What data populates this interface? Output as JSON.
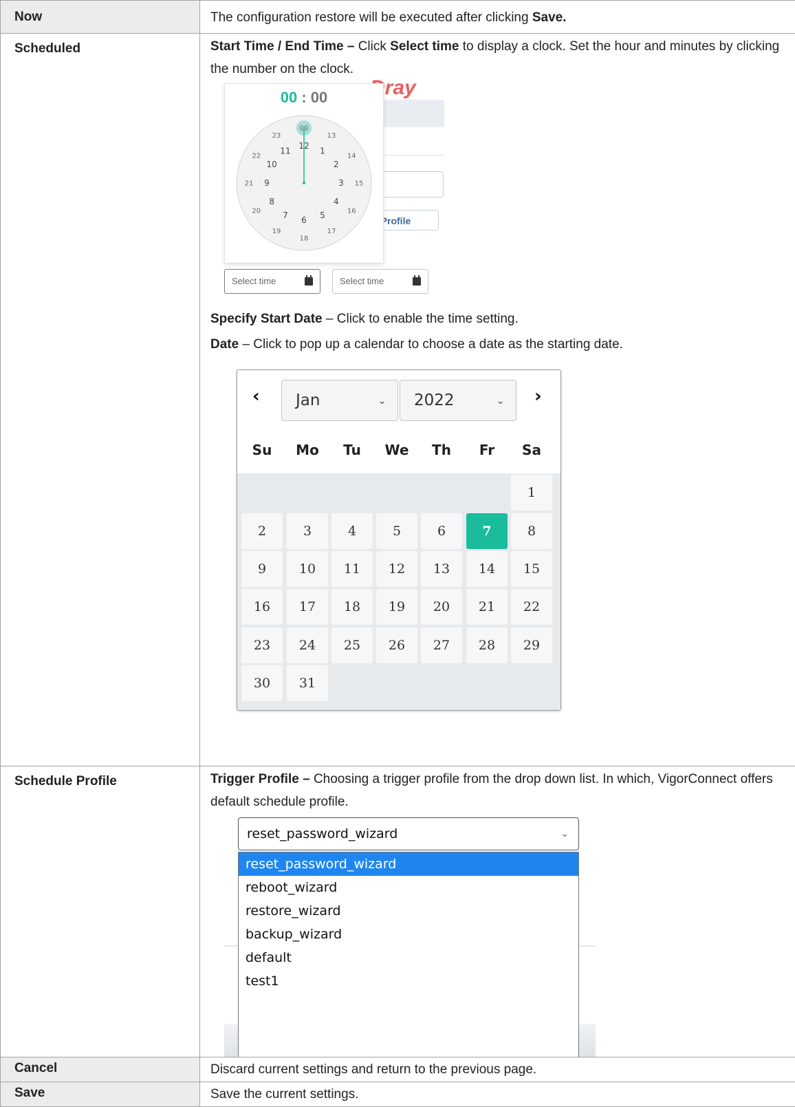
{
  "rows": {
    "now": {
      "term": "Now",
      "desc_prefix": "The configuration restore will be executed after clicking ",
      "desc_bold": "Save."
    },
    "scheduled": {
      "term": "Scheduled",
      "p1_bold": "Start Time / End Time – ",
      "p1_a": "Click ",
      "p1_b_bold": "Select time",
      "p1_c": " to display a clock. Set the hour and minutes by clicking the number on the clock.",
      "p2_bold": "Specify Start Date",
      "p2_text": " – Click to enable the time setting.",
      "p3_bold": "Date",
      "p3_text": " – Click to pop up a calendar to choose a date as the starting date."
    },
    "schedule_profile": {
      "term": "Schedule Profile",
      "p1_bold": "Trigger Profile – ",
      "p1_text": "Choosing a trigger profile from the drop down list. In which, VigorConnect offers default schedule profile."
    },
    "cancel": {
      "term": "Cancel",
      "desc": "Discard current settings and return to the previous page."
    },
    "save": {
      "term": "Save",
      "desc": "Save the current settings."
    }
  },
  "time_picker": {
    "hour": "00",
    "separator": ":",
    "minute": "00",
    "selected_hour_label": "00",
    "outer_hours": [
      "00",
      "13",
      "14",
      "15",
      "16",
      "17",
      "18",
      "19",
      "20",
      "21",
      "22",
      "23"
    ],
    "inner_hours": [
      "12",
      "1",
      "2",
      "3",
      "4",
      "5",
      "6",
      "7",
      "8",
      "9",
      "10",
      "11"
    ],
    "start_placeholder": "Select time",
    "end_placeholder": "Select time",
    "bg_logo": "Dray",
    "bg_button_label": "e Profile",
    "accent": "#1abc9c"
  },
  "calendar": {
    "month": "Jan",
    "year": "2022",
    "prev_glyph": "‹",
    "next_glyph": "›",
    "weekdays": [
      "Su",
      "Mo",
      "Tu",
      "We",
      "Th",
      "Fr",
      "Sa"
    ],
    "first_weekday_index": 6,
    "days_in_month": 31,
    "selected_day": 7,
    "accent": "#1abc9c"
  },
  "profile_dropdown": {
    "selected": "reset_password_wizard",
    "options": [
      "reset_password_wizard",
      "reboot_wizard",
      "restore_wizard",
      "backup_wizard",
      "default",
      "test1"
    ],
    "highlight_color": "#1f86f0"
  }
}
